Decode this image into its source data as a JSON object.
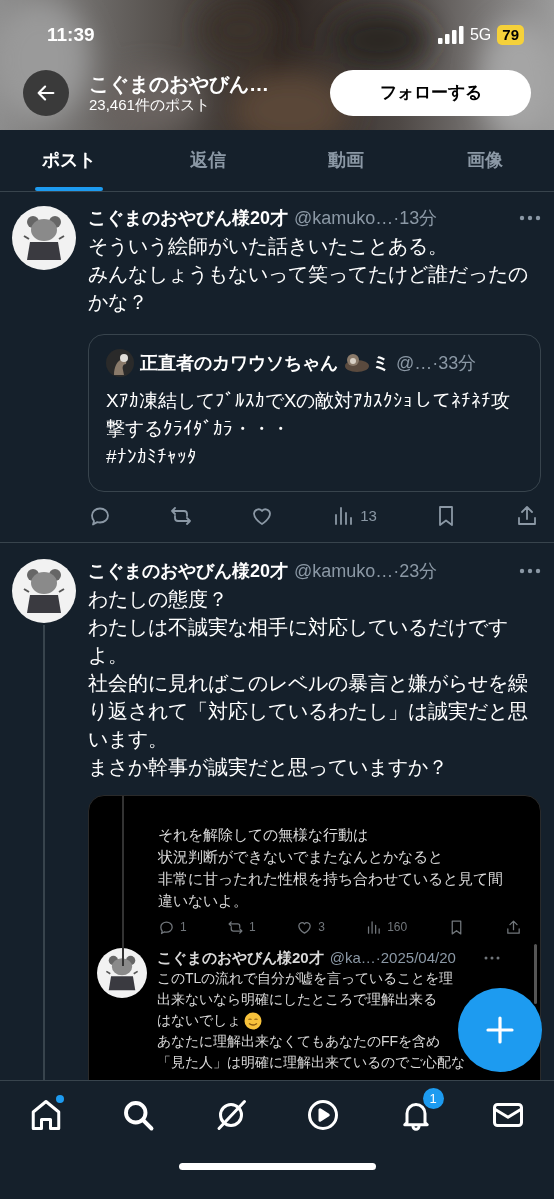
{
  "status_bar": {
    "time": "11:39",
    "network": "5G",
    "battery": "79"
  },
  "header": {
    "title": "こぐまのおやびん…",
    "post_count": "23,461件のポスト",
    "follow_button": "フォローする"
  },
  "tabs": [
    {
      "label": "ポスト",
      "selected": true
    },
    {
      "label": "返信",
      "selected": false
    },
    {
      "label": "動画",
      "selected": false
    },
    {
      "label": "画像",
      "selected": false
    }
  ],
  "posts": [
    {
      "author": "こぐまのおやびん様20才",
      "handle": "@kamuko…",
      "time": "·13分",
      "thread": false,
      "text": [
        "そういう絵師がいた話きいたことある。",
        "みんなしょうもないって笑ってたけど誰だったのかな？"
      ],
      "quote": {
        "author": "正直者のカワウソちゃん",
        "name_suffix": "ミ",
        "handle": "@…",
        "time": "·33分",
        "text": "Xｱｶ凍結してﾌﾞﾙｽｶでXの敵対ｱｶｽｸｼｮしてﾈﾁﾈﾁ攻撃するｸﾗｲﾀﾞｶﾗ・・・\n#ﾅﾝｶﾐﾁｬｯﾀ"
      },
      "actions": [
        {
          "kind": "reply"
        },
        {
          "kind": "repost"
        },
        {
          "kind": "like"
        },
        {
          "kind": "views",
          "count": "13"
        },
        {
          "kind": "bookmark"
        },
        {
          "kind": "share"
        }
      ]
    },
    {
      "author": "こぐまのおやびん様20才",
      "handle": "@kamuko…",
      "time": "·23分",
      "thread": true,
      "text": [
        "わたしの態度？",
        "わたしは不誠実な相手に対応しているだけですよ。",
        "社会的に見ればこのレベルの暴言と嫌がらせを繰り返されて「対応しているわたし」は誠実だと思います。",
        "まさか幹事が誠実だと思っていますか？"
      ],
      "media": {
        "text": [
          "それを解除しての無様な行動は",
          "状況判断ができないでまたなんとかなると",
          "非常に甘ったれた性根を持ち合わせていると見て間違いないよ。"
        ],
        "actions": [
          {
            "kind": "reply",
            "count": "1"
          },
          {
            "kind": "repost",
            "count": "1"
          },
          {
            "kind": "like",
            "count": "3"
          },
          {
            "kind": "views",
            "count": "160"
          },
          {
            "kind": "bookmark"
          },
          {
            "kind": "share"
          }
        ],
        "reply": {
          "author": "こぐまのおやびん様20才",
          "handle": "@ka…",
          "time": "·2025/04/20",
          "lines": [
            {
              "text": "このTLの流れで自分が嘘を言っていることを理",
              "kind": "plain"
            },
            {
              "text": "出来ないなら明確にしたところで理解出来る",
              "kind": "plain"
            },
            {
              "text": "はないでしょ",
              "kind": "with_emoji"
            },
            {
              "text": "あなたに理解出来なくてもあなたのFFを含め",
              "kind": "plain"
            },
            {
              "text": "「見た人」は明確に理解出来ているのでご心配な",
              "kind": "plain"
            }
          ]
        }
      }
    }
  ],
  "nav": [
    {
      "kind": "home",
      "dot": true
    },
    {
      "kind": "search"
    },
    {
      "kind": "grok"
    },
    {
      "kind": "video"
    },
    {
      "kind": "notifications",
      "badge": "1"
    },
    {
      "kind": "messages"
    }
  ]
}
